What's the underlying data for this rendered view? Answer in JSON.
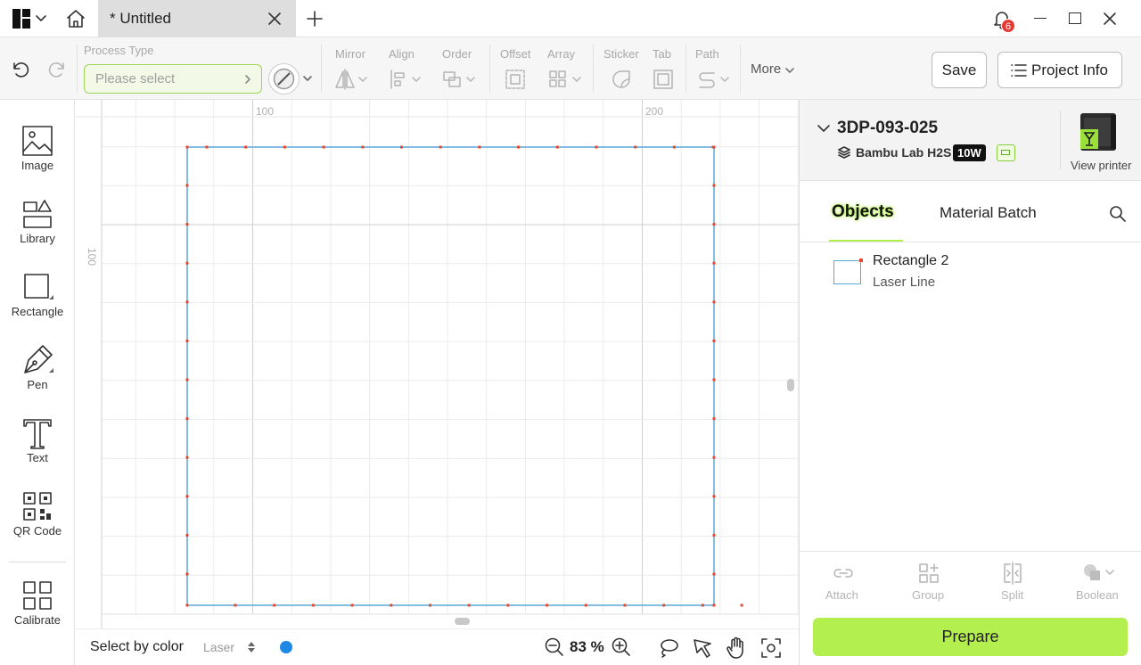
{
  "titlebar": {
    "tab_title": "* Untitled",
    "notification_count": "6"
  },
  "toolbar": {
    "process_type_label": "Process Type",
    "process_placeholder": "Please select",
    "mirror": "Mirror",
    "align": "Align",
    "order": "Order",
    "offset": "Offset",
    "array": "Array",
    "sticker": "Sticker",
    "tab": "Tab",
    "path": "Path",
    "more": "More",
    "save": "Save",
    "project_info": "Project Info"
  },
  "sidebar": {
    "items": [
      "Image",
      "Library",
      "Rectangle",
      "Pen",
      "Text",
      "QR Code",
      "Calibrate"
    ]
  },
  "canvas": {
    "ruler_top": [
      "100",
      "200"
    ],
    "ruler_left": [
      "100"
    ]
  },
  "bottombar": {
    "select_by_color": "Select by color",
    "mode": "Laser",
    "zoom": "83 %",
    "color_dot": "#1e88e5"
  },
  "printer": {
    "name": "3DP-093-025",
    "model": "Bambu Lab H2S",
    "power": "10W",
    "view_printer": "View printer"
  },
  "panel": {
    "tabs": [
      "Objects",
      "Material Batch"
    ],
    "objects": [
      {
        "name": "Rectangle 2",
        "type": "Laser Line"
      }
    ],
    "actions": [
      "Attach",
      "Group",
      "Split",
      "Boolean"
    ],
    "prepare": "Prepare"
  },
  "colors": {
    "accent": "#b3ef4e",
    "shape_stroke": "#5aa7d8",
    "node": "#e8462c",
    "badge": "#e53935"
  }
}
